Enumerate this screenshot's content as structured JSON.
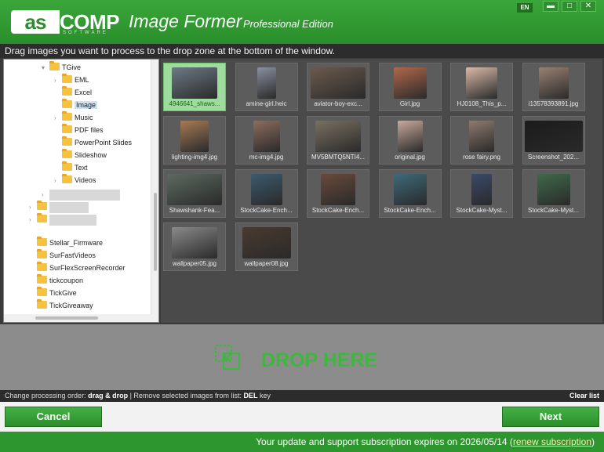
{
  "header": {
    "logo_main": "as",
    "logo_text": "COMP",
    "logo_sub": "SOFTWARE",
    "app_title": "Image Former",
    "edition": "Professional Edition",
    "lang": "EN"
  },
  "instructions": "Drag images you want to process to the drop zone at the bottom of the window.",
  "tree": {
    "items": [
      {
        "label": "TGive",
        "level": 0
      },
      {
        "label": "EML",
        "level": 1
      },
      {
        "label": "Excel",
        "level": 1
      },
      {
        "label": "Image",
        "level": 1,
        "selected": true
      },
      {
        "label": "Music",
        "level": 1
      },
      {
        "label": "PDF files",
        "level": 1
      },
      {
        "label": "PowerPoint Slides",
        "level": 1
      },
      {
        "label": "Slideshow",
        "level": 1
      },
      {
        "label": "Text",
        "level": 1
      },
      {
        "label": "Videos",
        "level": 1
      },
      {
        "label": "Stellar_Firmware",
        "level": -1
      },
      {
        "label": "SurFastVideos",
        "level": -1
      },
      {
        "label": "SurFlexScreenRecorder",
        "level": -1
      },
      {
        "label": "tickcoupon",
        "level": -1
      },
      {
        "label": "TickGive",
        "level": -1
      },
      {
        "label": "TickGiveaway",
        "level": -1
      }
    ]
  },
  "thumbnails": [
    {
      "caption": "4946641_shaws...",
      "color": "#6d7a86"
    },
    {
      "caption": "amine-girl.heic",
      "color": "#8a8fa0"
    },
    {
      "caption": "aviator-boy-exc...",
      "color": "#6b5a4d"
    },
    {
      "caption": "Girl.jpg",
      "color": "#b0684a"
    },
    {
      "caption": "HJ0108_This_p...",
      "color": "#d8b9a7"
    },
    {
      "caption": "i13578393891.jpg",
      "color": "#9a8171"
    },
    {
      "caption": "lighting-img4.jpg",
      "color": "#a77a55"
    },
    {
      "caption": "mc-img4.jpg",
      "color": "#8c6d5e"
    },
    {
      "caption": "MV5BMTQ5NTI4...",
      "color": "#7a7062"
    },
    {
      "caption": "original.jpg",
      "color": "#c7a99a"
    },
    {
      "caption": "rose fairy.png",
      "color": "#8e7a6e"
    },
    {
      "caption": "Screenshot_202...",
      "color": "#1b1b1b"
    },
    {
      "caption": "Shawshank-Fea...",
      "color": "#5d6a60"
    },
    {
      "caption": "StockCake-Ench...",
      "color": "#3b5a6e"
    },
    {
      "caption": "StockCake-Ench...",
      "color": "#6a4a3b"
    },
    {
      "caption": "StockCake-Ench...",
      "color": "#3f6a7a"
    },
    {
      "caption": "StockCake-Myst...",
      "color": "#3a4a6a"
    },
    {
      "caption": "StockCake-Myst...",
      "color": "#3f6a4a"
    },
    {
      "caption": "wallpaper05.jpg",
      "color": "#8a8a8a"
    },
    {
      "caption": "wallpaper08.jpg",
      "color": "#4a3a30"
    }
  ],
  "drop_zone": {
    "label": "DROP HERE"
  },
  "hint": {
    "order_label": "Change processing order:",
    "order_value": "drag & drop",
    "remove_label": "| Remove selected images from list:",
    "remove_key": "DEL",
    "remove_suffix": "key",
    "clear_list": "Clear list"
  },
  "buttons": {
    "cancel": "Cancel",
    "next": "Next"
  },
  "status": {
    "text": "Your update and support subscription expires on 2026/05/14 (",
    "link": "renew subscription",
    "close": ")"
  },
  "colors": {
    "brand_green": "#2e962e",
    "drop_green": "#3cb83c"
  }
}
